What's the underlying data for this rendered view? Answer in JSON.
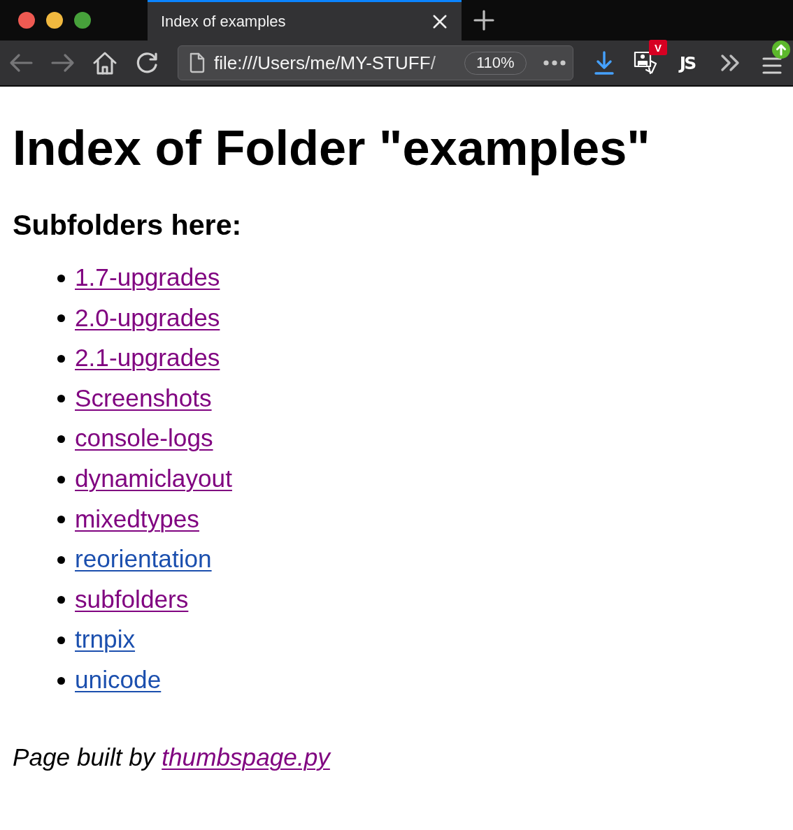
{
  "tabs": [
    {
      "title": "Index of examples",
      "selected": true
    }
  ],
  "toolbar": {
    "nav_buttons": [
      {
        "kind": "back",
        "disabled": true
      },
      {
        "kind": "forward",
        "disabled": true
      },
      {
        "kind": "home",
        "disabled": false
      },
      {
        "kind": "reload",
        "disabled": false
      }
    ],
    "address_bar": {
      "url": "file:///Users/me/MY-STUFF/",
      "zoom": "110%"
    },
    "extensions": [
      {
        "kind": "download"
      },
      {
        "kind": "pictures",
        "badge": "V"
      },
      {
        "kind": "script",
        "label": "JS"
      },
      {
        "kind": "overflow"
      },
      {
        "kind": "menu",
        "update_available": true
      }
    ]
  },
  "page": {
    "heading": "Index of Folder \"examples\"",
    "subheading": "Subfolders here:",
    "links": [
      {
        "text": "1.7-upgrades",
        "visited": true
      },
      {
        "text": "2.0-upgrades",
        "visited": true
      },
      {
        "text": "2.1-upgrades",
        "visited": true
      },
      {
        "text": "Screenshots",
        "visited": true
      },
      {
        "text": "console-logs",
        "visited": true
      },
      {
        "text": "dynamiclayout",
        "visited": true
      },
      {
        "text": "mixedtypes",
        "visited": true
      },
      {
        "text": "reorientation",
        "visited": false
      },
      {
        "text": "subfolders",
        "visited": true
      },
      {
        "text": "trnpix",
        "visited": false
      },
      {
        "text": "unicode",
        "visited": false
      }
    ],
    "footer": {
      "text": "Page built by",
      "link": {
        "text": "thumbspage.py",
        "visited": true
      }
    }
  }
}
